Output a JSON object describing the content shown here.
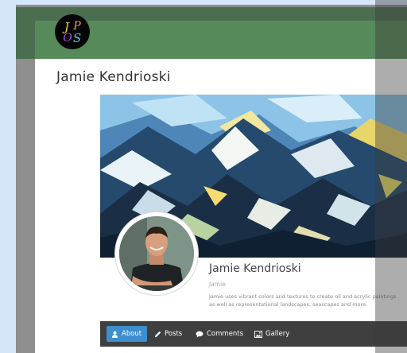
{
  "site": {
    "logo": {
      "icon": "jpos-logo-icon",
      "text": "JPOS",
      "colors": [
        "#f2c94c",
        "#f2994a",
        "#56ccf2",
        "#9b51e0"
      ]
    },
    "title": "Jamie Kendrioski"
  },
  "cover": {
    "icon": "mountain-painting-image"
  },
  "profile": {
    "avatar_icon": "profile-photo-avatar",
    "name": "Jamie Kendrioski",
    "username": "Jamie",
    "bio_line1": "Jamie uses vibrant colors and textures to create oil and acrylic paintings",
    "bio_line2": "as well as representational landscapes, seascapes and more."
  },
  "nav": {
    "about": {
      "label": "About",
      "icon": "user-icon",
      "active": true
    },
    "posts": {
      "label": "Posts",
      "icon": "pencil-icon"
    },
    "comments": {
      "label": "Comments",
      "icon": "comments-icon"
    },
    "gallery": {
      "label": "Gallery",
      "icon": "image-icon"
    }
  },
  "colors": {
    "header_dark": "#4a6e4f",
    "header_light": "#568a5a",
    "nav_bar": "#3f3f3f",
    "nav_active": "#3d8fcf"
  }
}
